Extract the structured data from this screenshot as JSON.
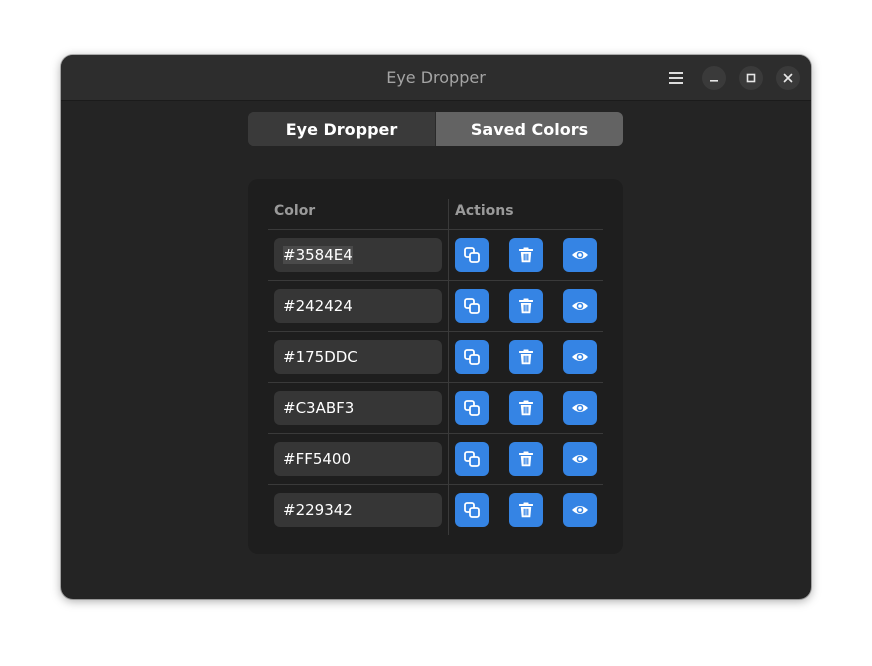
{
  "window": {
    "title": "Eye Dropper"
  },
  "headerbar": {
    "menu_icon": "hamburger-menu-icon",
    "minimize_icon": "minimize-icon",
    "maximize_icon": "maximize-icon",
    "close_icon": "close-icon"
  },
  "tabs": [
    {
      "label": "Eye Dropper",
      "active": false
    },
    {
      "label": "Saved Colors",
      "active": true
    }
  ],
  "table": {
    "headers": {
      "color": "Color",
      "actions": "Actions"
    },
    "rows": [
      {
        "hex": "#3584E4"
      },
      {
        "hex": "#242424"
      },
      {
        "hex": "#175DDC"
      },
      {
        "hex": "#C3ABF3"
      },
      {
        "hex": "#FF5400"
      },
      {
        "hex": "#229342"
      }
    ],
    "actions": [
      "copy-icon",
      "trash-icon",
      "eye-icon"
    ]
  },
  "colors": {
    "accent": "#3584e4",
    "window_bg": "#242424",
    "headerbar_bg": "#2d2d2d",
    "card_bg": "#1e1e1e",
    "active_tab": "#636363"
  }
}
